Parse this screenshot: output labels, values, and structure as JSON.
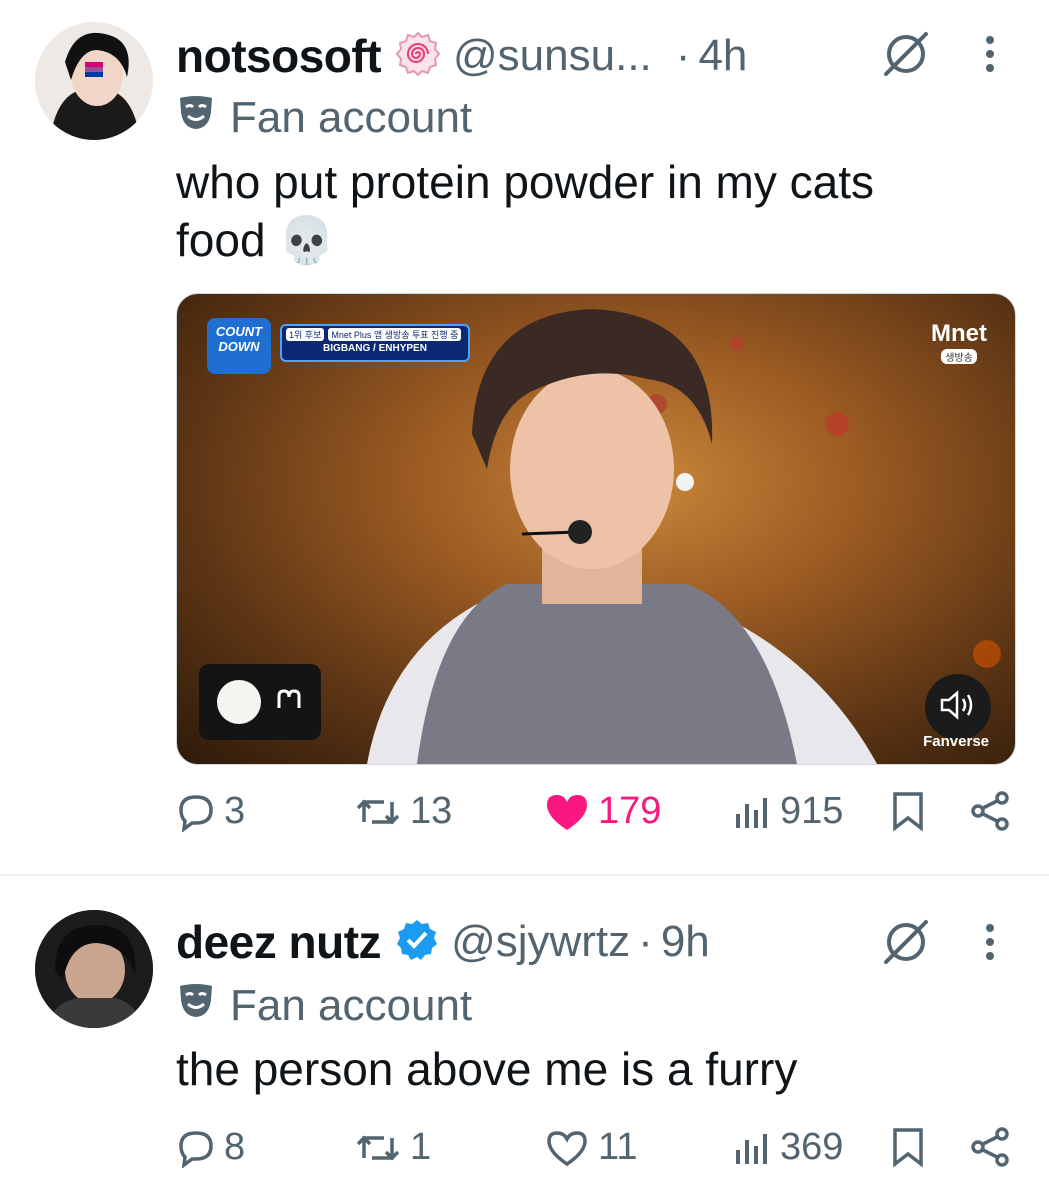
{
  "tweets": [
    {
      "display_name": "notsosoft",
      "handle": "@sunsu...",
      "separator": "·",
      "time": "4h",
      "label": "Fan account",
      "text_line1": "who put protein powder in my cats",
      "text_line2": "food 💀",
      "media": {
        "show_logo_line1": "COUNT",
        "show_logo_line2": "DOWN",
        "banner_rank": "1위 후보",
        "banner_notice": "Mnet Plus 앱 생방송 투표 진행 중",
        "banner_candidates": "BIGBANG / ENHYPEN",
        "channel_logo": "Mnet",
        "channel_sub": "생방송",
        "watermark": "Fanverse"
      },
      "stats": {
        "replies": "3",
        "reposts": "13",
        "likes": "179",
        "views": "915"
      },
      "liked": true
    },
    {
      "display_name": "deez nutz",
      "handle": "@sjywrtz",
      "separator": "·",
      "time": "9h",
      "label": "Fan account",
      "text_line1": "the person above me is a furry",
      "stats": {
        "replies": "8",
        "reposts": "1",
        "likes": "11",
        "views": "369"
      },
      "liked": false
    }
  ],
  "colors": {
    "like_active": "#f91880",
    "verified": "#1d9bf0",
    "muted": "#536471"
  }
}
